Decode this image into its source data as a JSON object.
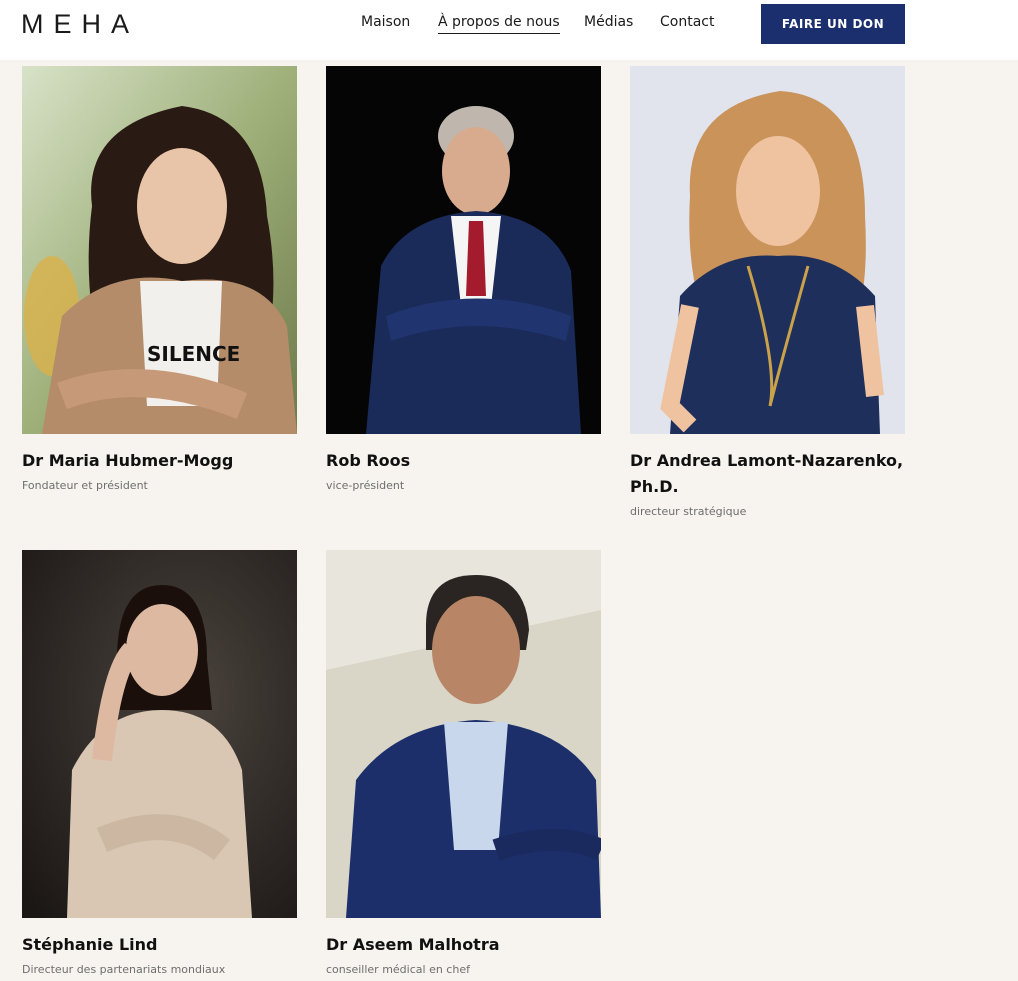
{
  "header": {
    "logo": "MEHA",
    "nav": [
      {
        "label": "Maison",
        "active": false
      },
      {
        "label": "À propos de nous",
        "active": true
      },
      {
        "label": "Médias",
        "active": false
      },
      {
        "label": "Contact",
        "active": false
      }
    ],
    "donate_label": "FAIRE UN DON"
  },
  "colors": {
    "background": "#f7f4ef",
    "donate_button": "#1b2f6e",
    "role_text": "#6e6e6e"
  },
  "team": [
    {
      "name": "Dr Maria Hubmer-Mogg",
      "role": "Fondateur et président"
    },
    {
      "name": "Rob Roos",
      "role": "vice-président"
    },
    {
      "name": "Dr Andrea Lamont-Nazarenko, Ph.D.",
      "role": "directeur stratégique"
    },
    {
      "name": "Stéphanie Lind",
      "role": "Directeur des partenariats mondiaux"
    },
    {
      "name": "Dr Aseem Malhotra",
      "role": "conseiller médical en chef"
    }
  ]
}
